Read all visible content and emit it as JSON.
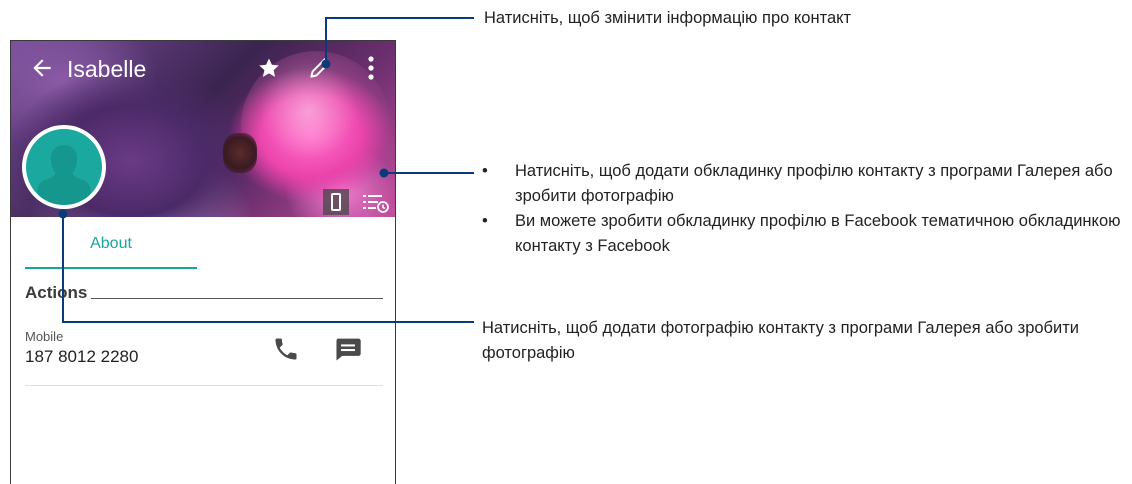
{
  "contact": {
    "name": "Isabelle",
    "tab_about": "About",
    "section_actions": "Actions",
    "phone_type": "Mobile",
    "phone_number": "187 8012 2280"
  },
  "icons": {
    "back": "back-arrow-icon",
    "favorite": "star-icon",
    "edit": "pencil-icon",
    "menu": "overflow-menu-icon",
    "avatar": "person-icon",
    "cover_phone": "phone-frame-icon",
    "cover_list": "list-timer-icon",
    "call": "phone-icon",
    "message": "message-icon"
  },
  "callouts": {
    "edit": "Натисніть, щоб змінити інформацію про контакт",
    "cover_bullets": [
      "Натисніть, щоб додати обкладинку профілю контакту з програми Галерея або зробити фотографію",
      "Ви можете зробити обкладинку профілю в Facebook тематичною обкладинкою контакту з Facebook"
    ],
    "photo": "Натисніть, щоб додати фотографію контакту з програми Галерея або зробити фотографію"
  },
  "colors": {
    "accent": "#1aa59a",
    "avatar_bg": "#1ba89e",
    "leader_line": "#0b3a7a"
  }
}
